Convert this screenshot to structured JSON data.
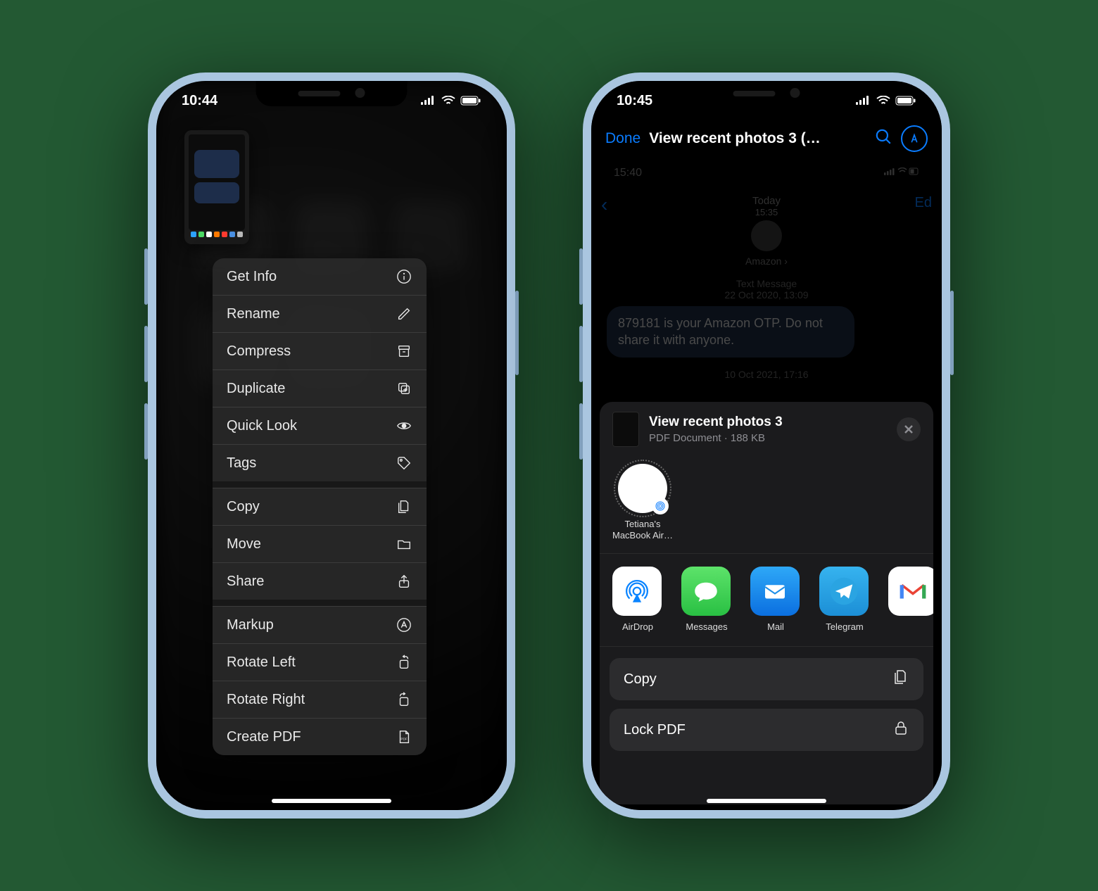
{
  "phone1": {
    "time": "10:44",
    "menu": {
      "get_info": "Get Info",
      "rename": "Rename",
      "compress": "Compress",
      "duplicate": "Duplicate",
      "quick_look": "Quick Look",
      "tags": "Tags",
      "copy": "Copy",
      "move": "Move",
      "share": "Share",
      "markup": "Markup",
      "rotate_left": "Rotate Left",
      "rotate_right": "Rotate Right",
      "create_pdf": "Create PDF"
    }
  },
  "phone2": {
    "time": "10:45",
    "nav": {
      "done": "Done",
      "title": "View recent photos 3 (…",
      "profile_letter": "A"
    },
    "preview": {
      "inner_time": "15:40",
      "today_label": "Today",
      "today_time": "15:35",
      "contact": "Amazon",
      "stamp1_label": "Text Message",
      "stamp1_time": "22 Oct 2020, 13:09",
      "bubble": "879181 is your Amazon OTP. Do not share it with anyone.",
      "stamp2": "10 Oct 2021, 17:16",
      "edit": "Ed"
    },
    "share": {
      "doc_title": "View recent photos 3",
      "doc_sub": "PDF Document · 188 KB",
      "airdrop_target": "Tetiana's MacBook Air…",
      "apps": {
        "airdrop": "AirDrop",
        "messages": "Messages",
        "mail": "Mail",
        "telegram": "Telegram"
      },
      "actions": {
        "copy": "Copy",
        "lock_pdf": "Lock PDF"
      }
    }
  }
}
